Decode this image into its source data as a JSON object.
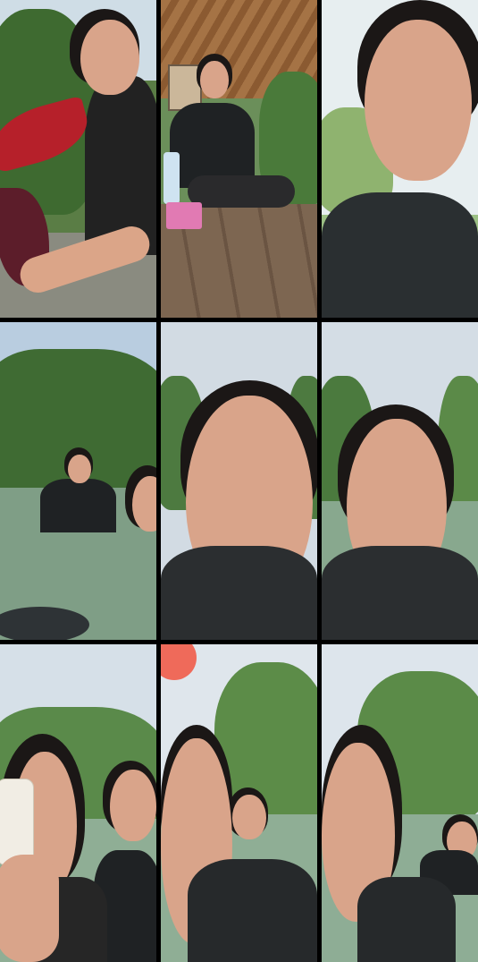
{
  "grid": {
    "columns": 3,
    "rows": 3,
    "tiles": [
      {
        "scene": "garden-selfie"
      },
      {
        "scene": "gazebo-seated"
      },
      {
        "scene": "closeup-selfie-bright"
      },
      {
        "scene": "river-wide"
      },
      {
        "scene": "river-closeup"
      },
      {
        "scene": "river-closeup-2"
      },
      {
        "scene": "river-phone-pair"
      },
      {
        "scene": "river-palms-pair"
      },
      {
        "scene": "river-palms-pair-2"
      }
    ]
  },
  "colors": {
    "gutter": "#000000",
    "foliage": "#3f6b33",
    "sky": "#d8e2ea",
    "water": "#6f8f7a",
    "wood": "#7a6652",
    "shirt": "#1f2224",
    "skin": "#d9a48a",
    "hair": "#1b1716"
  }
}
